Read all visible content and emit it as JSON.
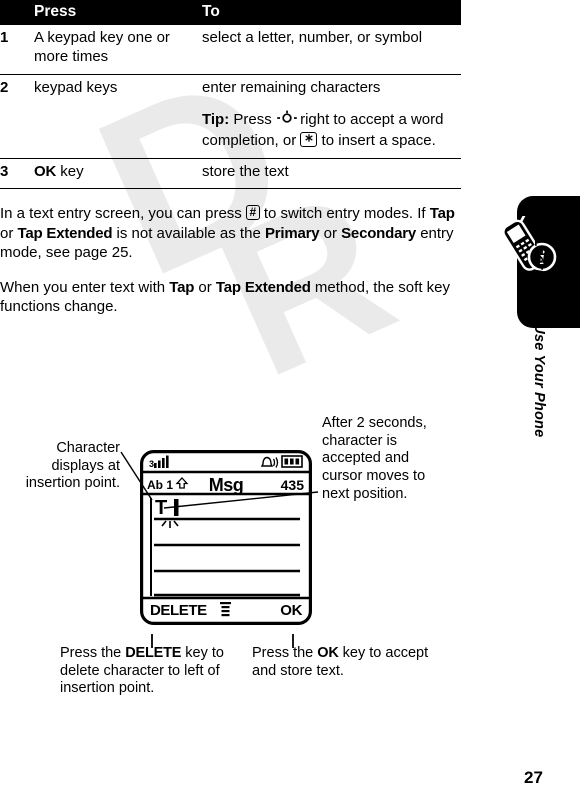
{
  "table": {
    "headers": [
      "",
      "Press",
      "To"
    ],
    "rows": [
      {
        "num": "1",
        "press": "A keypad key one or more times",
        "to": "select a letter, number, or symbol",
        "tip_label": "",
        "tip_text": ""
      },
      {
        "num": "2",
        "press": "keypad keys",
        "to": "enter remaining characters",
        "tip_label": "Tip:",
        "tip_pre": " Press ",
        "tip_mid": " right to accept a word completion, or ",
        "tip_key": "*",
        "tip_post": " to insert a space.",
        "tip_navkey": "navigation-key"
      },
      {
        "num": "3",
        "press": "OK",
        "press_suffix": " key",
        "to": "store the text"
      }
    ]
  },
  "paragraphs": {
    "p1_a": "In a text entry screen, you can press ",
    "p1_key": "#",
    "p1_b": " to switch entry modes. If ",
    "p1_tap": "Tap",
    "p1_c": " or ",
    "p1_tapext": "Tap Extended",
    "p1_d": " is not available as the ",
    "p1_primary": "Primary",
    "p1_e": " or ",
    "p1_secondary": "Secondary",
    "p1_f": " entry mode, see page 25.",
    "p2_a": "When you enter text with ",
    "p2_tap": "Tap",
    "p2_b": " or ",
    "p2_tapext": "Tap Extended",
    "p2_c": " method, the soft key functions change."
  },
  "diagram": {
    "callout_left": "Character displays at insertion point.",
    "callout_right": "After 2 seconds, character is accepted and cursor moves to next position.",
    "callout_bottom_left_a": "Press the ",
    "callout_bottom_left_key": "DELETE",
    "callout_bottom_left_b": " key to delete character to left of insertion point.",
    "callout_bottom_right_a": "Press the ",
    "callout_bottom_right_key": "OK",
    "callout_bottom_right_b": " key to accept and store text.",
    "phone": {
      "signal_icon": "signal-bars-icon",
      "alert_icon": "ringer-alert-icon",
      "battery_icon": "battery-icon",
      "mode_indicator": "Ab 1",
      "shift_icon": "shift-caps-icon",
      "title": "Msg",
      "char_count": "435",
      "entered_text": "T",
      "cursor": "text-cursor",
      "softkey_left": "DELETE",
      "softkey_center_icon": "menu-list-icon",
      "softkey_right": "OK"
    }
  },
  "sidebar": {
    "title": "Learning to Use Your Phone",
    "tab_icon": "phone-info-icon",
    "page_number": "27"
  },
  "watermark": {
    "text": "DRAFT"
  }
}
